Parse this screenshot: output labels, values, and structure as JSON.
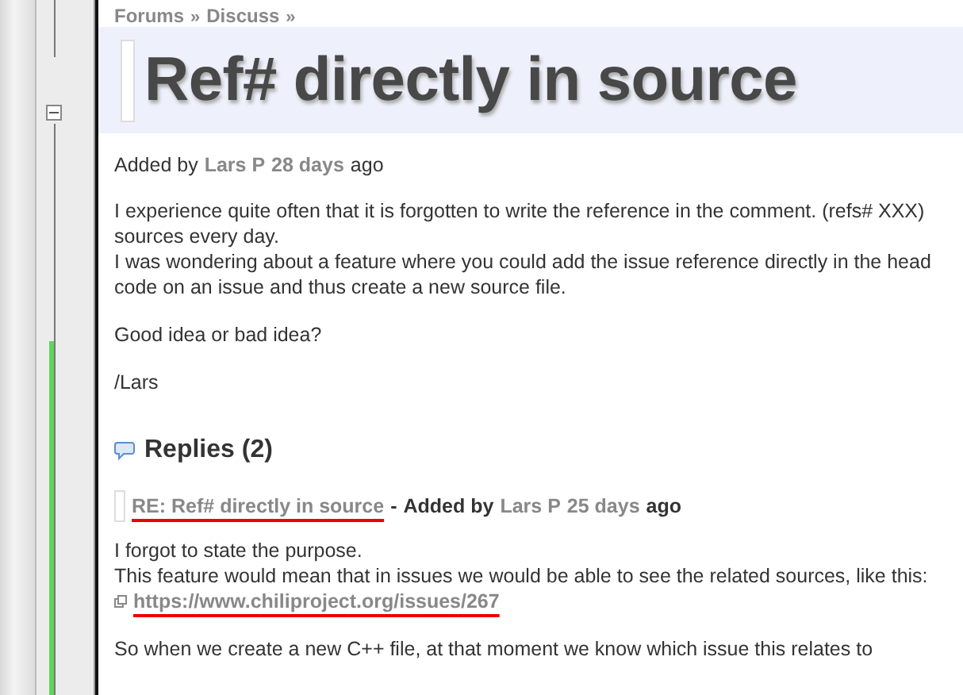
{
  "breadcrumb": [
    {
      "label": "Forums"
    },
    {
      "label": "Discuss"
    }
  ],
  "breadcrumb_separator": "»",
  "title": "Ref# directly in source",
  "meta": {
    "prefix": "Added by",
    "author": "Lars P",
    "age": "28 days",
    "suffix": "ago"
  },
  "body_paragraphs": [
    [
      "I experience quite often that it is forgotten to write the reference in the comment. (refs# XXX)",
      "sources every day.",
      "I was wondering about a feature where you could add the issue reference directly in the head",
      "code on an issue and thus create a new source file."
    ],
    [
      "Good idea or bad idea?"
    ],
    [
      "/Lars"
    ]
  ],
  "replies": {
    "heading": "Replies (2)",
    "items": [
      {
        "subject": "RE: Ref# directly in source",
        "separator": "-",
        "prefix": "Added by",
        "author": "Lars P",
        "age": "25 days",
        "suffix": "ago",
        "lines": [
          "I forgot to state the purpose.",
          "This feature would mean that in issues we would be able to see the related sources, like this:"
        ],
        "link": "https://www.chiliproject.org/issues/267",
        "after": "So when we create a new C++ file, at that moment we know which issue this relates to"
      }
    ]
  }
}
